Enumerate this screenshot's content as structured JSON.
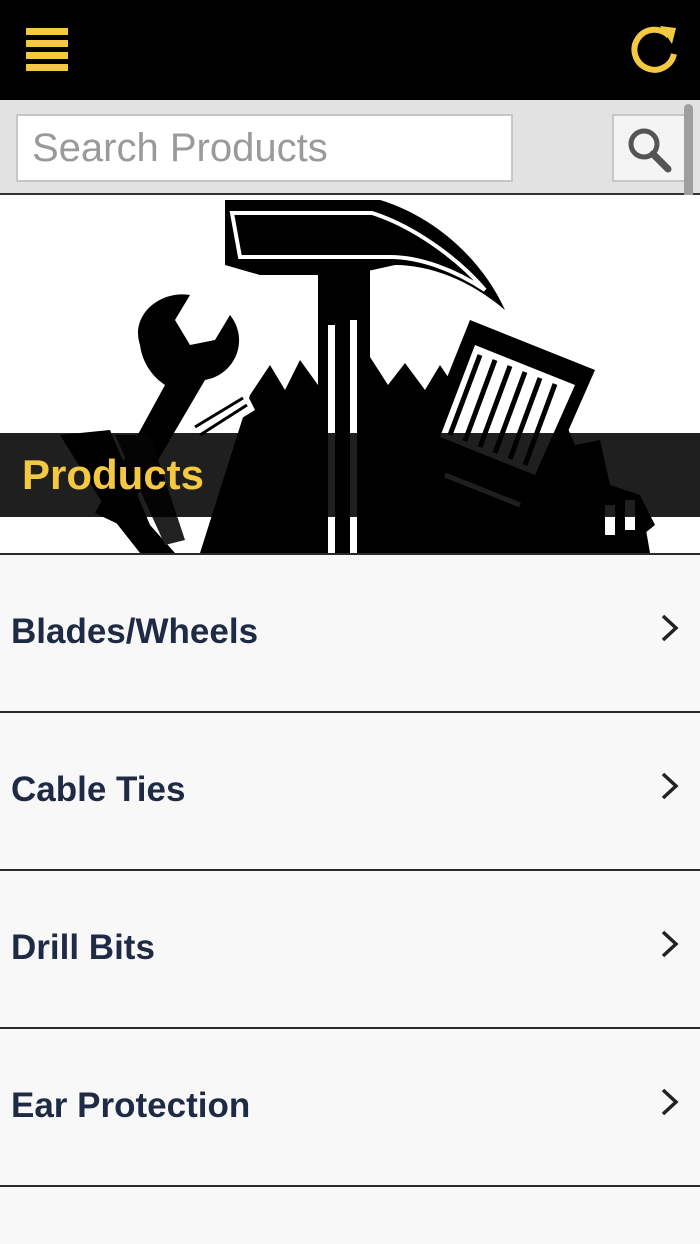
{
  "topbar": {
    "menu_icon": "hamburger-menu-icon",
    "refresh_icon": "refresh-icon",
    "accent_color": "#f5c842"
  },
  "search": {
    "placeholder": "Search Products",
    "value": "",
    "button_icon": "search-icon"
  },
  "hero": {
    "title": "Products",
    "image": "tools-illustration"
  },
  "categories": [
    {
      "label": "Blades/Wheels"
    },
    {
      "label": "Cable Ties"
    },
    {
      "label": "Drill Bits"
    },
    {
      "label": "Ear Protection"
    }
  ],
  "colors": {
    "topbar_bg": "#000000",
    "accent": "#f5c842",
    "list_text": "#1f2a44",
    "list_bg": "#f8f8f8"
  }
}
